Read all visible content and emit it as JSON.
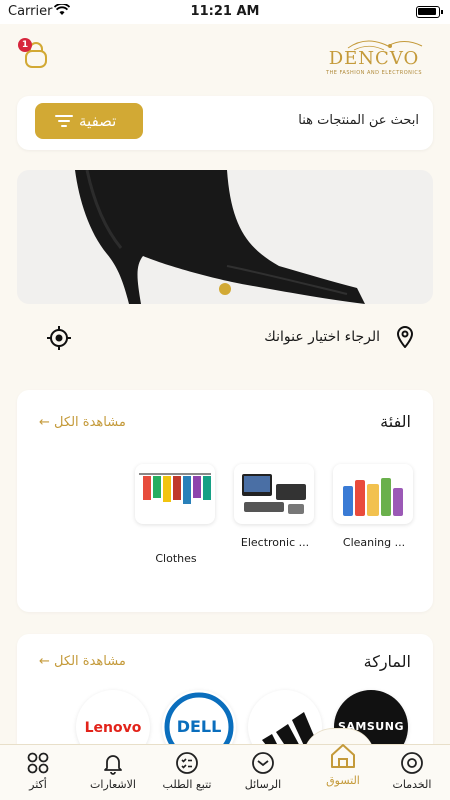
{
  "status_bar": {
    "carrier": "Carrier",
    "time": "11:21 AM"
  },
  "header": {
    "cart_count": "1",
    "logo_text": "DENCVO",
    "logo_sub": "THE FASHION AND ELECTRONICS"
  },
  "search": {
    "placeholder": "ابحث عن المنتجات هنا",
    "filter_label": "تصفية"
  },
  "address": {
    "label": "الرجاء اختيار عنوانك"
  },
  "categories": {
    "title": "الفئة",
    "see_all": "مشاهدة الكل",
    "items": [
      {
        "label": "Cleaning ...",
        "icon": "cleaning-products"
      },
      {
        "label": "Electronic ...",
        "icon": "electronics"
      },
      {
        "label": "Clothes",
        "icon": "clothes-rack"
      }
    ]
  },
  "brands": {
    "title": "الماركة",
    "see_all": "مشاهدة الكل",
    "items": [
      {
        "name": "SAMSUNG",
        "bg": "#111111",
        "fg": "#ffffff"
      },
      {
        "name": "adidas",
        "bg": "#ffffff",
        "fg": "#111111"
      },
      {
        "name": "DELL",
        "bg": "#ffffff",
        "fg": "#0a6ebd"
      },
      {
        "name": "Lenovo",
        "bg": "#ffffff",
        "fg": "#e2231a"
      }
    ]
  },
  "tabs": [
    {
      "label": "الخدمات",
      "icon": "services-icon"
    },
    {
      "label": "التسوق",
      "icon": "shop-icon",
      "active": true
    },
    {
      "label": "الرسائل",
      "icon": "messages-icon"
    },
    {
      "label": "تتبع الطلب",
      "icon": "track-order-icon"
    },
    {
      "label": "الاشعارات",
      "icon": "bell-icon"
    },
    {
      "label": "أكثر",
      "icon": "more-icon"
    }
  ],
  "colors": {
    "accent": "#d2a934",
    "background": "#fbf8f1",
    "badge": "#d7263d"
  }
}
